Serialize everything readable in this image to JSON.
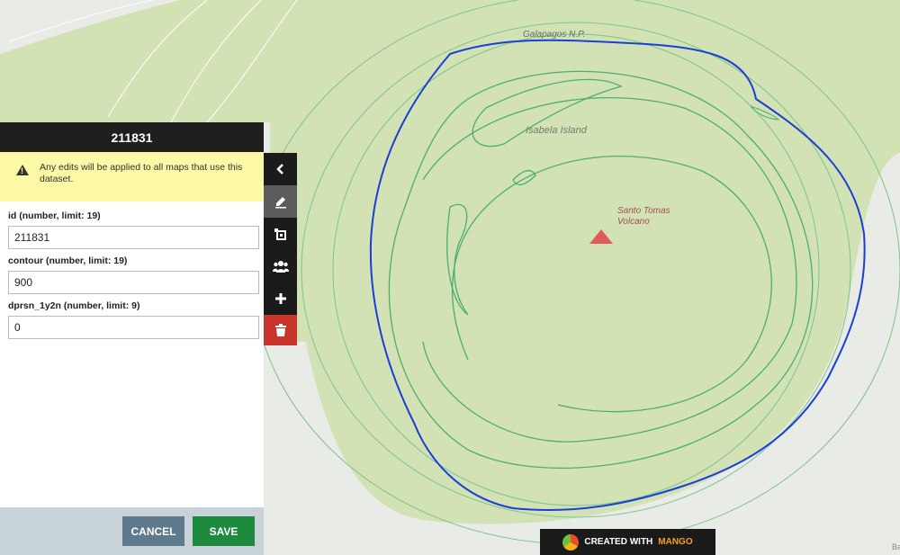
{
  "map": {
    "labels": {
      "park": "Galapagos N.P.",
      "island": "Isabela Island",
      "volcano_line1": "Santo Tomas",
      "volcano_line2": "Volcano"
    },
    "attribution": "Ba",
    "colors": {
      "land": "#d2e2b4",
      "water": "#e8ebe6",
      "contour": "#4caf6a",
      "selected": "#1a3fd6",
      "volcano": "#e05a5a"
    }
  },
  "panel": {
    "title": "211831",
    "warning": "Any edits will be applied to all maps that use this dataset.",
    "fields": [
      {
        "label": "id (number, limit: 19)",
        "value": "211831"
      },
      {
        "label": "contour (number, limit: 19)",
        "value": "900"
      },
      {
        "label": "dprsn_1y2n (number, limit: 9)",
        "value": "0"
      }
    ],
    "cancel_label": "CANCEL",
    "save_label": "SAVE"
  },
  "toolbar": {
    "tools": [
      {
        "name": "collapse",
        "icon": "chevron-left-icon"
      },
      {
        "name": "edit",
        "icon": "pencil-icon"
      },
      {
        "name": "transform",
        "icon": "transform-icon"
      },
      {
        "name": "group",
        "icon": "users-icon"
      },
      {
        "name": "add",
        "icon": "plus-icon"
      },
      {
        "name": "delete",
        "icon": "trash-icon"
      }
    ]
  },
  "badge": {
    "text": "CREATED WITH",
    "accent": "MANGO"
  }
}
